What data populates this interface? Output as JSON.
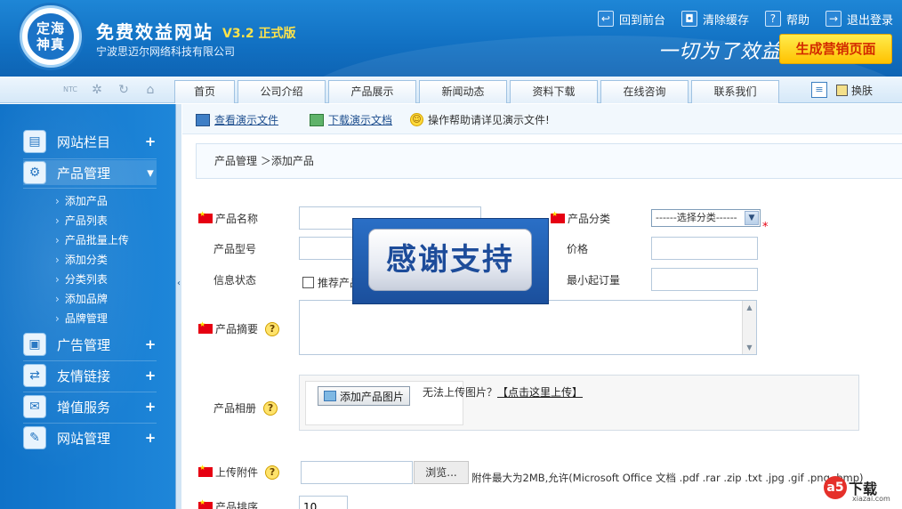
{
  "header": {
    "logo_text": "定海\n神真",
    "title": "免费效益网站",
    "version": "V3.2 正式版",
    "company": "宁波思迈尔网络科技有限公司",
    "links": [
      {
        "icon": "home-return-icon",
        "label": "回到前台"
      },
      {
        "icon": "trash-icon",
        "label": "清除缓存"
      },
      {
        "icon": "help-icon",
        "label": "帮助"
      },
      {
        "icon": "logout-icon",
        "label": "退出登录"
      }
    ],
    "slogan": "一切为了效益",
    "generate_button": "生成营销页面"
  },
  "nav": {
    "icons": [
      "ntc-icon",
      "gear-icon",
      "refresh-icon",
      "home-icon"
    ],
    "tabs": [
      "首页",
      "公司介绍",
      "产品展示",
      "新闻动态",
      "资料下载",
      "在线咨询",
      "联系我们"
    ],
    "skin_label": "换肤"
  },
  "sidebar": {
    "sections": [
      {
        "icon": "columns-icon",
        "label": "网站栏目",
        "toggle": "+"
      },
      {
        "icon": "gears-icon",
        "label": "产品管理",
        "toggle": "▾"
      },
      {
        "icon": "ad-icon",
        "label": "广告管理",
        "toggle": "+"
      },
      {
        "icon": "link-icon",
        "label": "友情链接",
        "toggle": "+"
      },
      {
        "icon": "chat-icon",
        "label": "增值服务",
        "toggle": "+"
      },
      {
        "icon": "wrench-icon",
        "label": "网站管理",
        "toggle": "+"
      }
    ],
    "product_sub_items": [
      "添加产品",
      "产品列表",
      "产品批量上传",
      "添加分类",
      "分类列表",
      "添加品牌",
      "品牌管理"
    ]
  },
  "helpbar": {
    "view_demo": "查看演示文件",
    "download_demo": "下载演示文档",
    "hint": "操作帮助请详见演示文件!"
  },
  "breadcrumb": "产品管理 ＞添加产品",
  "form": {
    "product_name_label": "产品名称",
    "category_label": "产品分类",
    "category_selected": "------选择分类------",
    "model_label": "产品型号",
    "price_label": "价格",
    "status_label": "信息状态",
    "recommend_label": "推荐产品",
    "min_order_label": "最小起订量",
    "summary_label": "产品摘要",
    "album_label": "产品相册",
    "add_image_button": "添加产品图片",
    "upload_fail_text": "无法上传图片？",
    "upload_fail_link": "【点击这里上传】",
    "attachment_label": "上传附件",
    "browse_button": "浏览...",
    "attachment_hint": "附件最大为2MB,允许(Microsoft Office 文档 .pdf .rar .zip .txt .jpg .gif .png .bmp)",
    "sort_label": "产品排序",
    "sort_value": "10"
  },
  "overlay": {
    "text": "感谢支持"
  },
  "watermark": {
    "logo": "a5",
    "text": "下载",
    "sub": "xiazai.com"
  }
}
